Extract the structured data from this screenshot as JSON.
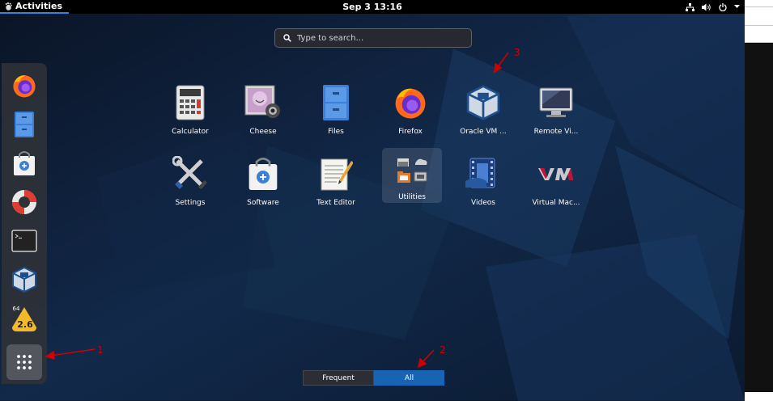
{
  "topbar": {
    "activities_label": "Activities",
    "clock": "Sep 3  13:16",
    "icons": [
      "network-icon",
      "volume-icon",
      "power-icon",
      "menu-arrow-icon"
    ]
  },
  "search": {
    "placeholder": "Type to search..."
  },
  "dash": {
    "items": [
      {
        "name": "firefox",
        "icon": "firefox-icon"
      },
      {
        "name": "files",
        "icon": "file-cabinet-icon"
      },
      {
        "name": "software",
        "icon": "software-bag-icon"
      },
      {
        "name": "help",
        "icon": "lifebuoy-icon"
      },
      {
        "name": "terminal",
        "icon": "terminal-icon"
      },
      {
        "name": "virtualbox",
        "icon": "virtualbox-cube-icon"
      },
      {
        "name": "app-2.6",
        "icon": "badge-icon",
        "badge_top": "64",
        "badge_text": "2.6"
      }
    ],
    "show_apps_icon": "app-grid-icon"
  },
  "apps": [
    {
      "label": "Calculator",
      "icon": "calculator-icon"
    },
    {
      "label": "Cheese",
      "icon": "cheese-icon"
    },
    {
      "label": "Files",
      "icon": "file-cabinet-icon"
    },
    {
      "label": "Firefox",
      "icon": "firefox-icon"
    },
    {
      "label": "Oracle VM ...",
      "icon": "virtualbox-cube-icon"
    },
    {
      "label": "Remote Vi...",
      "icon": "monitor-icon"
    },
    {
      "label": "Settings",
      "icon": "tools-icon"
    },
    {
      "label": "Software",
      "icon": "software-bag-icon"
    },
    {
      "label": "Text Editor",
      "icon": "text-editor-icon"
    },
    {
      "label": "Utilities",
      "icon": "utilities-folder-icon",
      "selected": true
    },
    {
      "label": "Videos",
      "icon": "film-icon"
    },
    {
      "label": "Virtual Mac...",
      "icon": "vm-logo-icon"
    }
  ],
  "switcher": {
    "frequent_label": "Frequent",
    "all_label": "All",
    "active": "All"
  },
  "annotations": [
    "1",
    "2",
    "3"
  ],
  "colors": {
    "accent": "#1963b5",
    "annotation": "#d10000",
    "topbar": "#000000"
  }
}
